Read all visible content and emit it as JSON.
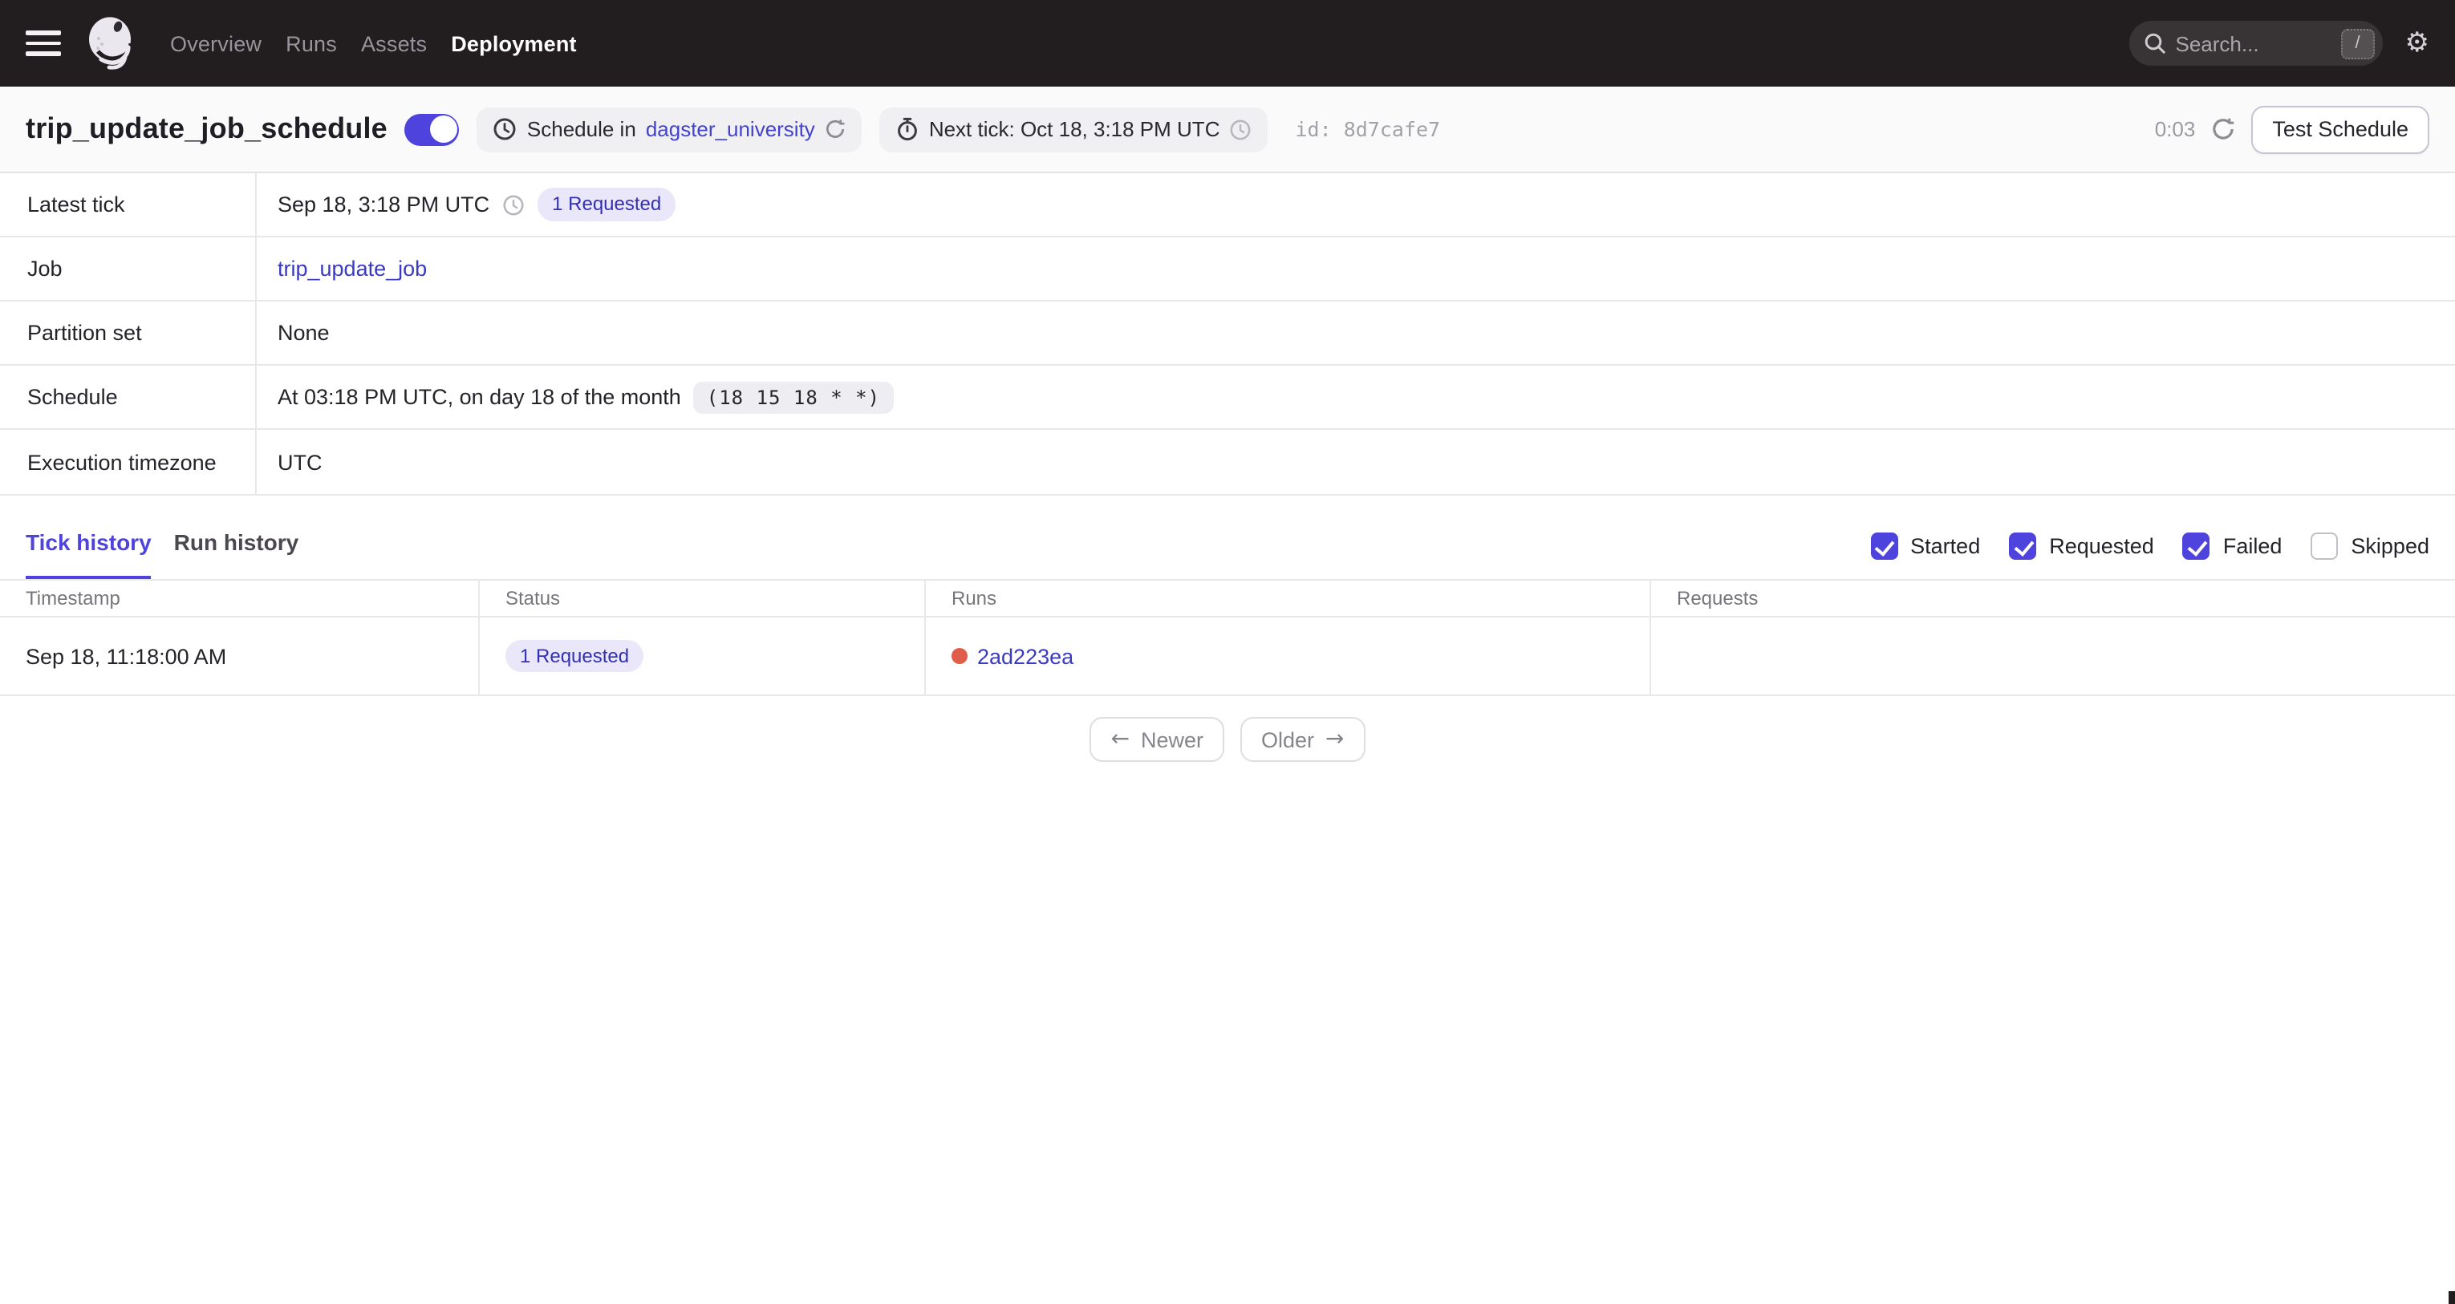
{
  "nav": {
    "items": [
      {
        "label": "Overview",
        "active": false
      },
      {
        "label": "Runs",
        "active": false
      },
      {
        "label": "Assets",
        "active": false
      },
      {
        "label": "Deployment",
        "active": true
      }
    ],
    "search": {
      "placeholder": "Search...",
      "shortcut": "/"
    }
  },
  "header": {
    "title": "trip_update_job_schedule",
    "toggle_on": true,
    "schedule_prefix": "Schedule in",
    "schedule_repo": "dagster_university",
    "next_tick": "Next tick: Oct 18, 3:18 PM UTC",
    "id_label": "id:",
    "id_value": "8d7cafe7",
    "countdown": "0:03",
    "test_button": "Test Schedule"
  },
  "details": {
    "rows": [
      {
        "label": "Latest tick",
        "time": "Sep 18, 3:18 PM UTC",
        "badge": "1 Requested"
      },
      {
        "label": "Job",
        "link": "trip_update_job"
      },
      {
        "label": "Partition set",
        "value": "None"
      },
      {
        "label": "Schedule",
        "text": "At 03:18 PM UTC, on day 18 of the month",
        "cron": "(18 15 18 * *)"
      },
      {
        "label": "Execution timezone",
        "value": "UTC"
      }
    ]
  },
  "tabs": [
    {
      "label": "Tick history",
      "active": true
    },
    {
      "label": "Run history",
      "active": false
    }
  ],
  "filters": [
    {
      "label": "Started",
      "checked": true
    },
    {
      "label": "Requested",
      "checked": true
    },
    {
      "label": "Failed",
      "checked": true
    },
    {
      "label": "Skipped",
      "checked": false
    }
  ],
  "tick_table": {
    "headers": [
      "Timestamp",
      "Status",
      "Runs",
      "Requests"
    ],
    "rows": [
      {
        "timestamp": "Sep 18, 11:18:00 AM",
        "status_badge": "1 Requested",
        "run_id": "2ad223ea",
        "run_status": "failed",
        "requests": ""
      }
    ]
  },
  "pagination": {
    "newer_arrow": "←",
    "newer_label": "Newer",
    "older_label": "Older",
    "older_arrow": "→"
  },
  "icons": {
    "gear": "⚙"
  },
  "colors": {
    "accent": "#4F43DD",
    "link": "#3A3AC2",
    "nav_bg": "#221E20",
    "badge_bg": "#E9E7F9",
    "badge_text": "#3430B4",
    "run_dot_failed": "#E05C4B",
    "header_bg": "#FAFAFB"
  }
}
